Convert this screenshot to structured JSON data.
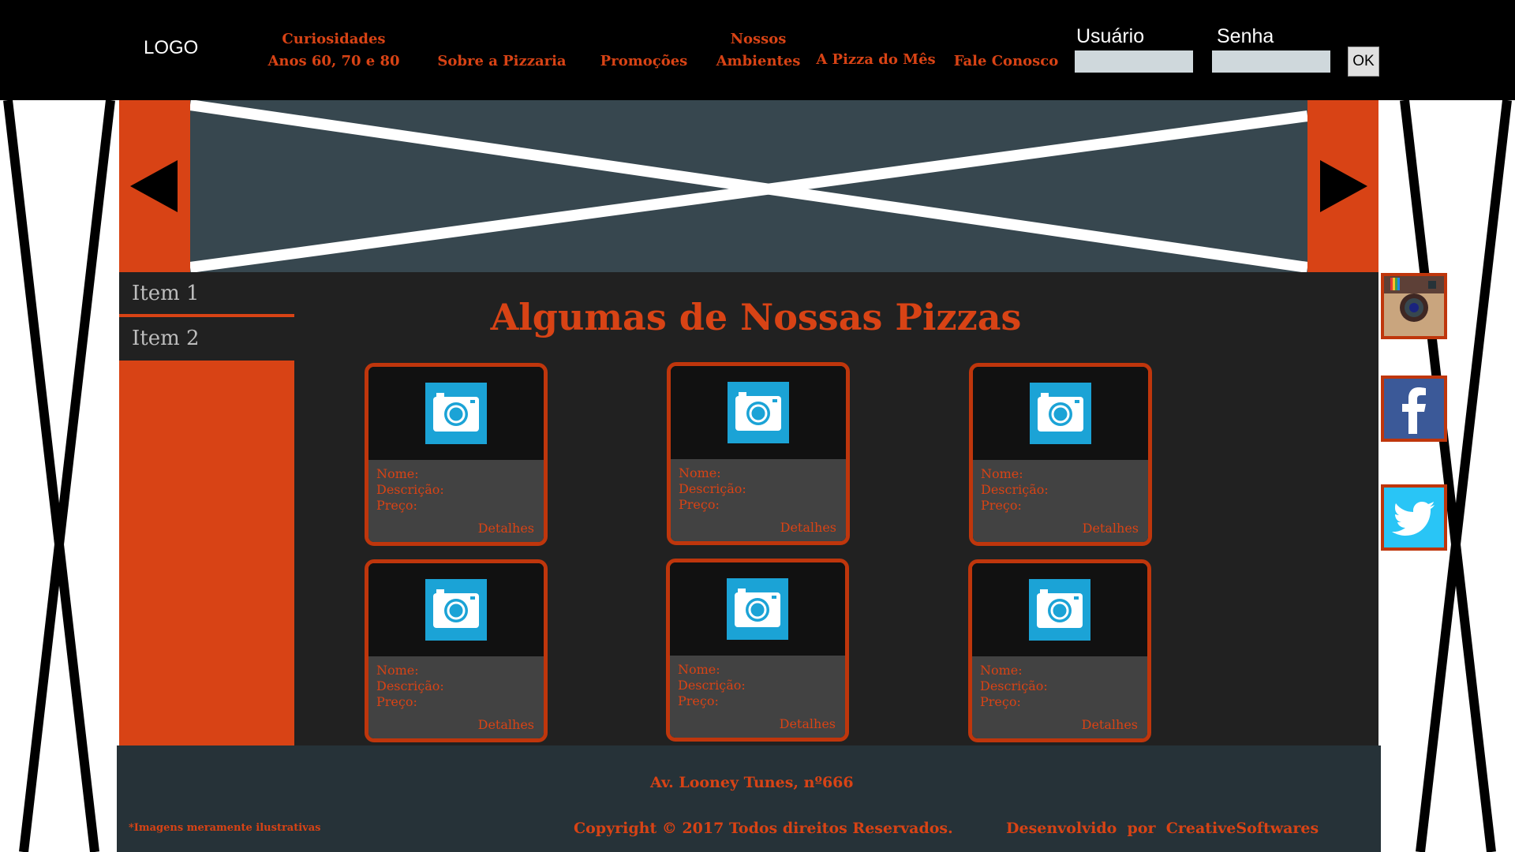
{
  "header": {
    "logo": "LOGO",
    "nav": [
      {
        "line1": "Curiosidades",
        "line2": "Anos 60, 70 e 80"
      },
      {
        "line1": "",
        "line2": "Sobre a Pizzaria"
      },
      {
        "line1": "",
        "line2": "Promoções"
      },
      {
        "line1": "Nossos",
        "line2": "Ambientes"
      },
      {
        "line1": "",
        "line2": "A Pizza do Mês"
      },
      {
        "line1": "",
        "line2": "Fale Conosco"
      }
    ],
    "login": {
      "user_label": "Usuário",
      "user_value": "",
      "password_label": "Senha",
      "password_value": "",
      "ok_label": "OK"
    }
  },
  "slider": {
    "prev_icon": "arrow-left-icon",
    "next_icon": "arrow-right-icon"
  },
  "sidebar": {
    "items": [
      {
        "label": "Item 1"
      },
      {
        "label": "Item 2"
      }
    ]
  },
  "main": {
    "title": "Algumas de Nossas Pizzas",
    "cards": [
      {
        "name_label": "Nome:",
        "description_label": "Descrição:",
        "price_label": "Preço:",
        "details_label": "Detalhes"
      },
      {
        "name_label": "Nome:",
        "description_label": "Descrição:",
        "price_label": "Preço:",
        "details_label": "Detalhes"
      },
      {
        "name_label": "Nome:",
        "description_label": "Descrição:",
        "price_label": "Preço:",
        "details_label": "Detalhes"
      },
      {
        "name_label": "Nome:",
        "description_label": "Descrição:",
        "price_label": "Preço:",
        "details_label": "Detalhes"
      },
      {
        "name_label": "Nome:",
        "description_label": "Descrição:",
        "price_label": "Preço:",
        "details_label": "Detalhes"
      },
      {
        "name_label": "Nome:",
        "description_label": "Descrição:",
        "price_label": "Preço:",
        "details_label": "Detalhes"
      }
    ]
  },
  "social": [
    {
      "icon": "instagram-icon"
    },
    {
      "icon": "facebook-icon"
    },
    {
      "icon": "twitter-icon"
    }
  ],
  "footer": {
    "address": "Av. Looney Tunes, nº666",
    "disclaimer": "*Imagens meramente ilustrativas",
    "copyright": "Copyright © 2017 Todos direitos Reservados.",
    "developer": "Desenvolvido  por  CreativeSoftwares"
  },
  "colors": {
    "accent": "#d84315",
    "header_bg": "#000000",
    "slider_bg": "#37474f",
    "content_bg": "#212121",
    "footer_bg": "#263238",
    "camera_icon": "#1ba3d6"
  }
}
